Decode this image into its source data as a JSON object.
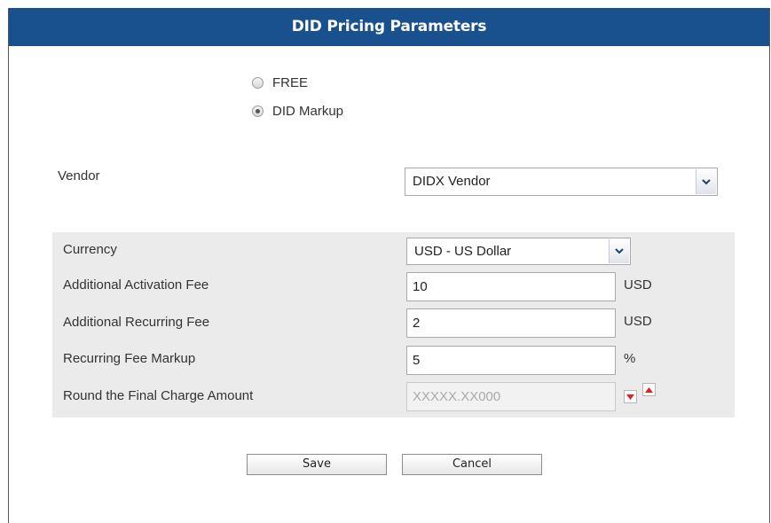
{
  "dialog": {
    "title": "DID Pricing Parameters"
  },
  "pricing_mode": {
    "options": [
      {
        "label": "FREE",
        "selected": false
      },
      {
        "label": "DID Markup",
        "selected": true
      }
    ]
  },
  "vendor": {
    "label": "Vendor",
    "value": "DIDX Vendor"
  },
  "fees": {
    "currency": {
      "label": "Currency",
      "value": "USD - US Dollar"
    },
    "activation": {
      "label": "Additional Activation Fee",
      "value": "10",
      "unit": "USD"
    },
    "recurring": {
      "label": "Additional Recurring Fee",
      "value": "2",
      "unit": "USD"
    },
    "markup": {
      "label": "Recurring Fee Markup",
      "value": "5",
      "unit": "%"
    },
    "round": {
      "label": "Round the Final Charge Amount",
      "value": "XXXXX.XX000"
    }
  },
  "actions": {
    "save_label": "Save",
    "cancel_label": "Cancel"
  },
  "colors": {
    "title_bar": "#18518d",
    "section_bg": "#ebebeb",
    "spin_arrow": "#e02020"
  }
}
